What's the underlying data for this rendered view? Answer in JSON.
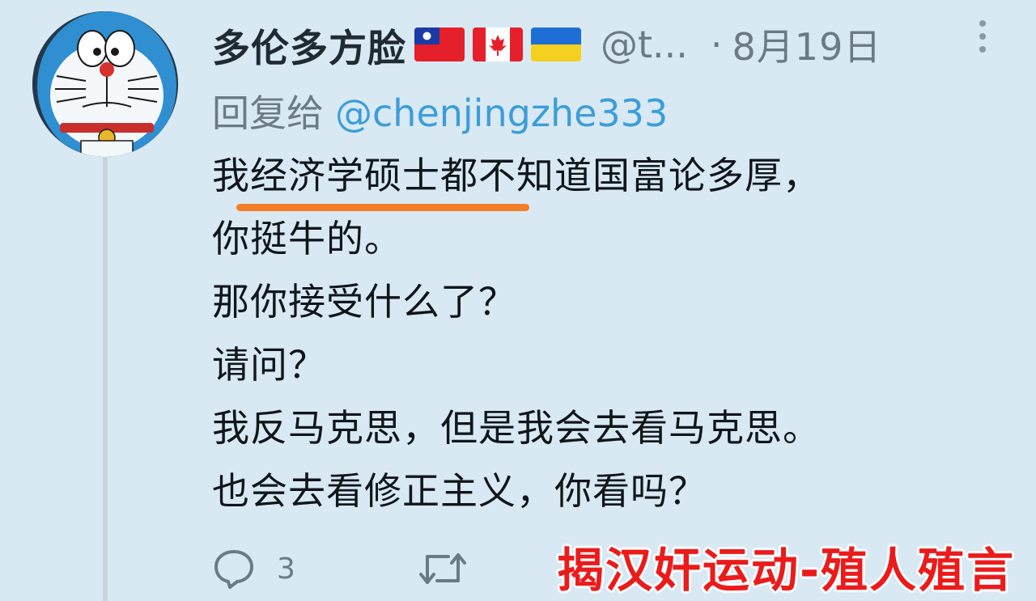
{
  "tweet": {
    "display_name": "多伦多方脸",
    "flags": [
      "taiwan-flag",
      "canada-flag",
      "ukraine-flag"
    ],
    "handle": "@t...",
    "separator": "·",
    "date": "8月19日",
    "reply_prefix": "回复给",
    "reply_handle": "@chenjingzhe333",
    "body_lines": [
      "我经济学硕士都不知道国富论多厚，",
      "你挺牛的。",
      "那你接受什么了？",
      "请问？",
      "我反马克思，但是我会去看马克思。",
      "也会去看修正主义，你看吗？"
    ],
    "underline_color": "#f47d28",
    "actions": {
      "reply_icon": "speech-bubble-icon",
      "reply_count": "3",
      "retweet_icon": "retweet-icon"
    }
  },
  "watermark": {
    "text": "揭汉奸运动-殖人殖言",
    "color": "#ec1b1b"
  },
  "colors": {
    "background": "#d9e9f3",
    "link": "#3c9ed9",
    "muted": "#6c7a85",
    "text": "#10161b"
  }
}
